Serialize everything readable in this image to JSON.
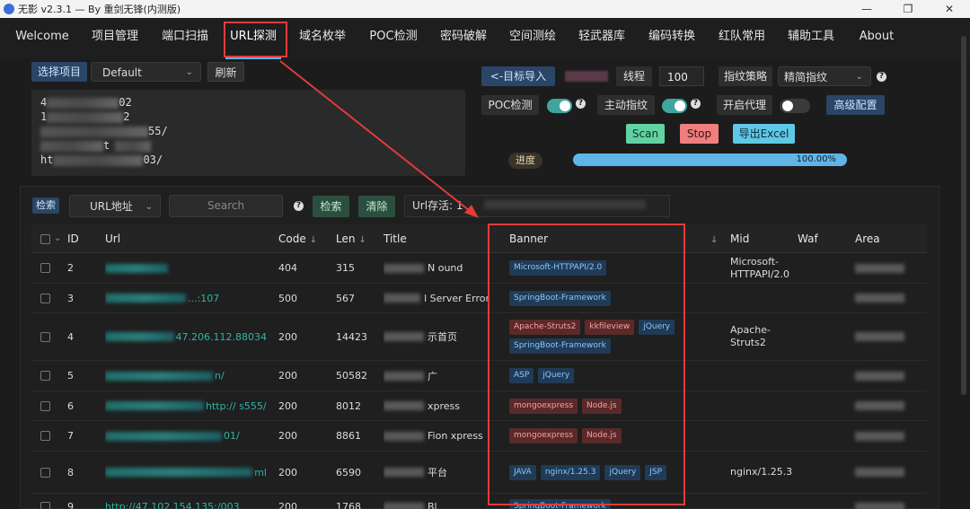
{
  "window": {
    "title": "无影 v2.3.1 — By 重剑无锋(内测版)",
    "min": "—",
    "max": "❐",
    "close": "✕"
  },
  "nav": {
    "tabs": [
      "Welcome",
      "项目管理",
      "端口扫描",
      "URL探测",
      "域名枚举",
      "POC检测",
      "密码破解",
      "空间测绘",
      "轻武器库",
      "编码转换",
      "红队常用",
      "辅助工具",
      "About"
    ],
    "active": "URL探测"
  },
  "project": {
    "select_label": "选择项目",
    "selected": "Default",
    "refresh": "刷新"
  },
  "targets": {
    "lines": [
      {
        "prefix": "4",
        "suffix": "02"
      },
      {
        "prefix": "1",
        "suffix": "2"
      },
      {
        "prefix": "",
        "suffix": "55/"
      },
      {
        "prefix": "",
        "suffix": "t"
      },
      {
        "prefix": "ht",
        "suffix": "03/"
      }
    ]
  },
  "controls": {
    "import_btn": "<-目标导入",
    "threads_label": "线程",
    "threads_value": "100",
    "strategy_label": "指纹策略",
    "strategy_value": "精简指纹",
    "poc_label": "POC检测",
    "active_fp_label": "主动指纹",
    "proxy_label": "开启代理",
    "advanced": "高级配置",
    "scan": "Scan",
    "stop": "Stop",
    "export": "导出Excel",
    "progress_label": "进度",
    "progress_value": 1.0,
    "progress_text": "100.00%",
    "help": "?"
  },
  "filter": {
    "search_btn_small": "检索",
    "field": "URL地址",
    "placeholder": "Search",
    "search_btn": "检索",
    "clear_btn": "清除",
    "alive_label": "Url存活: 1"
  },
  "table": {
    "headers": {
      "id": "ID",
      "url": "Url",
      "code": "Code",
      "len": "Len",
      "title": "Title",
      "banner": "Banner",
      "mid": "Mid",
      "waf": "Waf",
      "area": "Area"
    },
    "rows": [
      {
        "id": "2",
        "url_text": "",
        "code": "404",
        "len": "315",
        "title": "N     ound",
        "mid": "Microsoft-HTTPAPI/2.0",
        "tags": [
          {
            "t": "Microsoft-HTTPAPI/2.0",
            "c": "blue"
          }
        ]
      },
      {
        "id": "3",
        "url_text": "...:107",
        "code": "500",
        "len": "567",
        "title": "l Server Error",
        "mid": "",
        "tags": [
          {
            "t": "SpringBoot-Framework",
            "c": "blue"
          }
        ]
      },
      {
        "id": "4",
        "url_text": "47.206.112.88034",
        "code": "200",
        "len": "14423",
        "title": "示首页",
        "mid": "Apache-Struts2",
        "tags": [
          {
            "t": "Apache-Struts2",
            "c": "red"
          },
          {
            "t": "kkfileview",
            "c": "red"
          },
          {
            "t": "jQuery",
            "c": "blue"
          },
          {
            "t": "SpringBoot-Framework",
            "c": "blue"
          }
        ]
      },
      {
        "id": "5",
        "url_text": "n/",
        "code": "200",
        "len": "50582",
        "title": "广",
        "mid": "",
        "tags": [
          {
            "t": "ASP",
            "c": "blue"
          },
          {
            "t": "jQuery",
            "c": "blue"
          }
        ]
      },
      {
        "id": "6",
        "url_text": "http://   s555/",
        "code": "200",
        "len": "8012",
        "title": "xpress",
        "mid": "",
        "tags": [
          {
            "t": "mongoexpress",
            "c": "red"
          },
          {
            "t": "Node.js",
            "c": "red"
          }
        ]
      },
      {
        "id": "7",
        "url_text": "01/",
        "code": "200",
        "len": "8861",
        "title": "Fion     xpress",
        "mid": "",
        "tags": [
          {
            "t": "mongoexpress",
            "c": "red"
          },
          {
            "t": "Node.js",
            "c": "red"
          }
        ]
      },
      {
        "id": "8",
        "url_text": "ml",
        "code": "200",
        "len": "6590",
        "title": "平台",
        "mid": "nginx/1.25.3",
        "tags": [
          {
            "t": "JAVA",
            "c": "blue"
          },
          {
            "t": "nginx/1.25.3",
            "c": "blue"
          },
          {
            "t": "jQuery",
            "c": "blue"
          },
          {
            "t": "JSP",
            "c": "blue"
          }
        ]
      },
      {
        "id": "9",
        "url_text": "http://47.102.154.135:/003",
        "code": "200",
        "len": "1768",
        "title": "Bl",
        "mid": "",
        "tags": [
          {
            "t": "SpringBoot-Framework",
            "c": "blue"
          }
        ]
      }
    ]
  },
  "colors": {
    "accent_blue": "#5ab0ff",
    "annotation_red": "#e23b3b",
    "scan_green": "#62d2a2",
    "stop_red": "#ef7f7f",
    "export_cyan": "#5fc8e6"
  }
}
